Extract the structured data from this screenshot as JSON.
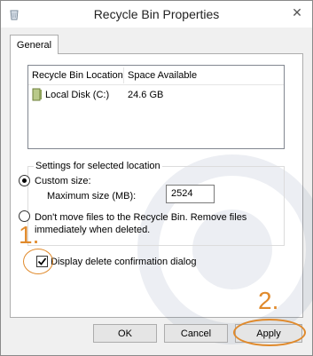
{
  "window": {
    "title": "Recycle Bin Properties",
    "close_glyph": "✕",
    "app_icon": "recycle-bin-icon"
  },
  "tabs": [
    {
      "label": "General",
      "selected": true
    }
  ],
  "list": {
    "columns": [
      "Recycle Bin Location",
      "Space Available"
    ],
    "rows": [
      {
        "location": "Local Disk (C:)",
        "space": "24.6 GB",
        "icon": "disk-drive-icon"
      }
    ]
  },
  "settings": {
    "legend": "Settings for selected location",
    "custom_size_label": "Custom size:",
    "custom_size_selected": true,
    "max_size_label": "Maximum size (MB):",
    "max_size_value": "2524",
    "dont_move_label": "Don't move files to the Recycle Bin. Remove files immediately when deleted.",
    "dont_move_selected": false
  },
  "confirm_dialog": {
    "label": "Display delete confirmation dialog",
    "checked": true
  },
  "buttons": {
    "ok": "OK",
    "cancel": "Cancel",
    "apply": "Apply"
  },
  "annotations": {
    "step1": "1.",
    "step2": "2.",
    "color": "#e08a2c"
  },
  "colors": {
    "window_bg": "#f0f0f0",
    "panel_bg": "#ffffff",
    "border": "#adadad"
  }
}
